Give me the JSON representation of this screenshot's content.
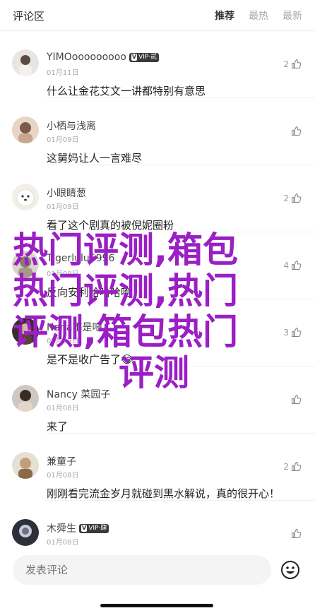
{
  "header": {
    "title": "评论区",
    "tabs": [
      {
        "label": "推荐",
        "active": true
      },
      {
        "label": "最热",
        "active": false
      },
      {
        "label": "最新",
        "active": false
      }
    ]
  },
  "comments": [
    {
      "user": "YIMOooooooooo",
      "badge": "VIP·贰",
      "date": "01月11日",
      "text": "什么让金花艾文一讲都特别有意思",
      "likes": "2"
    },
    {
      "user": "小栖与浅离",
      "badge": "",
      "date": "01月09日",
      "text": "这舅妈让人一言难尽",
      "likes": ""
    },
    {
      "user": "小眼睛葱",
      "badge": "",
      "date": "01月09日",
      "text": "看了这个剧真的被倪妮圈粉",
      "likes": "2"
    },
    {
      "user": "Tigerlulu5996",
      "badge": "",
      "date": "01月09日",
      "text": "反向安利哈哈哈哈",
      "likes": "4"
    },
    {
      "user": "Nana不是吧",
      "badge": "",
      "date": "01月09日",
      "text": "是不是收广告了😂",
      "likes": "3"
    },
    {
      "user": "Nancy 菜园子",
      "badge": "",
      "date": "01月08日",
      "text": "来了",
      "likes": ""
    },
    {
      "user": "兼童子",
      "badge": "",
      "date": "01月08日",
      "text": "刚刚看完流金岁月就碰到黑水解说，真的很开心！",
      "likes": "2"
    },
    {
      "user": "木舜生",
      "badge": "VIP·肆",
      "date": "01月08日",
      "text": "",
      "likes": ""
    }
  ],
  "overlay": {
    "lines": [
      "热门评测,箱包",
      "热门评测,热门",
      "评测,箱包热门",
      "评测"
    ]
  },
  "input": {
    "placeholder": "发表评论"
  },
  "colors": {
    "overlay": "#9a1fc4",
    "active_tab": "#333333",
    "muted": "#aaaaaa"
  },
  "icons": {
    "like": "thumbs-up-icon",
    "emoji": "smiley-icon"
  }
}
